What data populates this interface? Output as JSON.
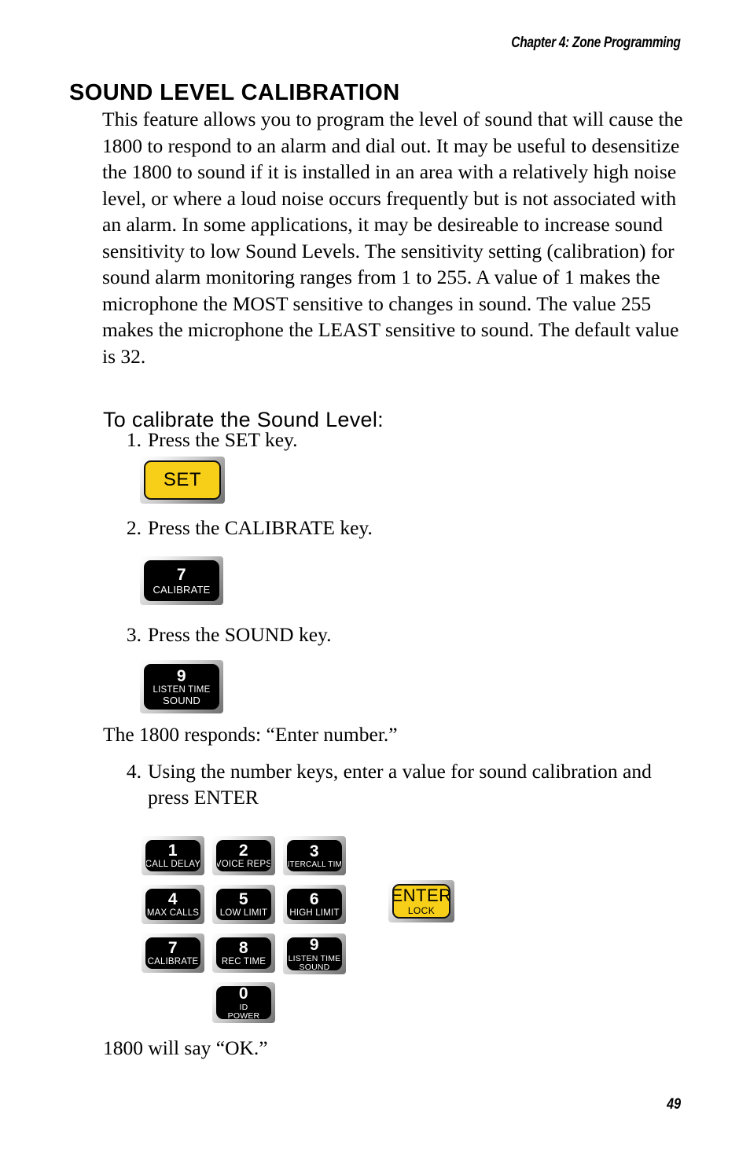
{
  "header": {
    "running_head": "Chapter 4: Zone Programming"
  },
  "heading": {
    "title": "SOUND LEVEL CALIBRATION"
  },
  "intro": {
    "paragraph": "This feature allows you to program the level of sound that will cause the 1800 to respond to an alarm and dial out. It may be useful to desensitize the 1800 to sound if it is installed in an area with a relatively high noise level, or where a loud noise occurs frequently but is not associated with an alarm. In some applications, it may be desireable to increase sound sensitivity to low Sound Levels. The sensitivity setting (calibration) for sound alarm monitoring ranges from 1 to 255.  A value of 1 makes the microphone the MOST sensitive to changes in sound.  The value 255 makes the microphone the LEAST sensitive to sound.  The default value is 32."
  },
  "subheading": {
    "title": "To calibrate the Sound Level:"
  },
  "steps": [
    {
      "number": "1.",
      "text": "Press the SET key."
    },
    {
      "number": "2.",
      "text": "Press the CALIBRATE key."
    },
    {
      "number": "3.",
      "text": "Press the SOUND key."
    },
    {
      "number": "4.",
      "text": "Using the number keys, enter a value for sound calibration and press ENTER"
    }
  ],
  "notes": {
    "responds": "The 1800 responds: “Enter number.”",
    "will_say": "1800 will say “OK.”"
  },
  "step_keys": {
    "set": {
      "word": "SET"
    },
    "calibrate": {
      "digit": "7",
      "label": "CALIBRATE"
    },
    "sound": {
      "digit": "9",
      "label": "LISTEN TIME",
      "label2": "SOUND"
    }
  },
  "keypad": {
    "keys": [
      {
        "digit": "1",
        "label": "CALL DELAY"
      },
      {
        "digit": "2",
        "label": "VOICE REPS"
      },
      {
        "digit": "3",
        "label": "INTERCALL TIME"
      },
      {
        "digit": "4",
        "label": "MAX CALLS"
      },
      {
        "digit": "5",
        "label": "LOW LIMIT"
      },
      {
        "digit": "6",
        "label": "HIGH LIMIT"
      },
      {
        "digit": "7",
        "label": "CALIBRATE"
      },
      {
        "digit": "8",
        "label": "REC TIME"
      },
      {
        "digit": "9",
        "label": "LISTEN TIME",
        "label2": "SOUND"
      },
      {
        "digit": "0",
        "label": "ID",
        "label2": "POWER"
      }
    ],
    "enter": {
      "word": "ENTER",
      "sublabel": "LOCK"
    }
  },
  "footer": {
    "page_number": "49"
  },
  "colors": {
    "key_yellow": "#f7cf18",
    "key_black": "#000000",
    "bezel_silver": "#c9c9c9",
    "text": "#000000"
  }
}
